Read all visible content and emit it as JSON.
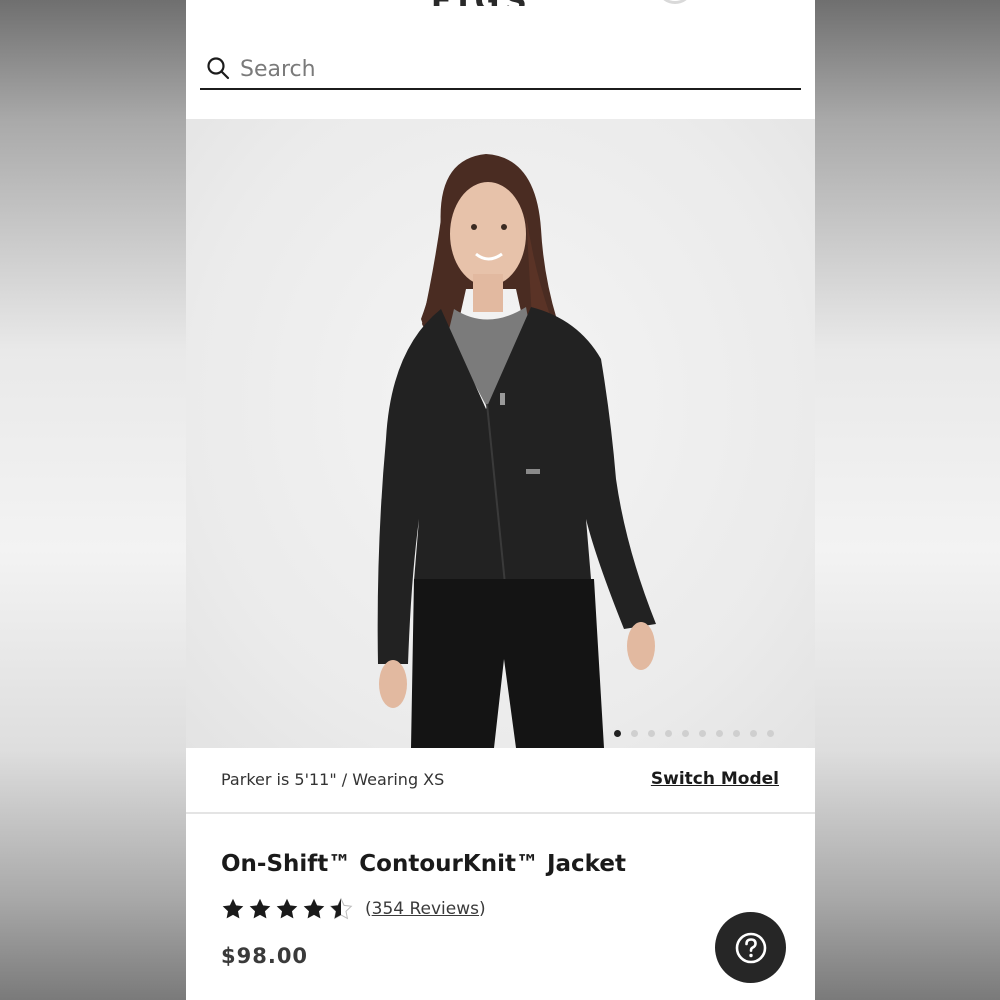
{
  "header": {
    "logo_text": "FIGS"
  },
  "search": {
    "placeholder": "Search",
    "value": ""
  },
  "gallery": {
    "image_count": 10,
    "active_index": 0,
    "image_alt": "Model wearing black zip-up jacket"
  },
  "model_bar": {
    "info": "Parker is 5'11\" / Wearing XS",
    "switch_label": "Switch Model"
  },
  "product": {
    "title": "On-Shift™ ContourKnit™ Jacket",
    "rating_value": 4.5,
    "rating_max": 5,
    "reviews_count": "354 Reviews",
    "price": "$98.00"
  },
  "help": {
    "icon": "question-icon"
  },
  "colors": {
    "jacket": "#222222",
    "text": "#1a1a1a",
    "help_bg": "#262626"
  }
}
